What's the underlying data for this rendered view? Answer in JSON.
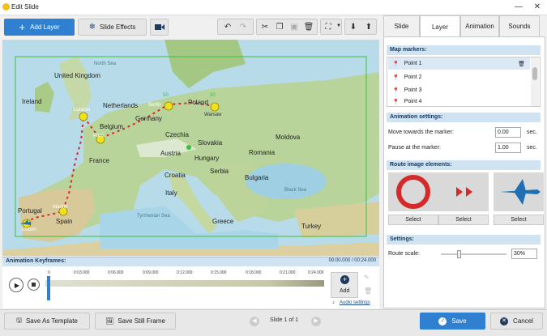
{
  "window": {
    "title": "Edit Slide",
    "minimize": "—",
    "close": "✕"
  },
  "toolbar": {
    "add_layer": "Add Layer",
    "slide_effects": "Slide Effects"
  },
  "map_labels": {
    "north_sea": "North Sea",
    "united_kingdom": "United Kingdom",
    "ireland": "Ireland",
    "london": "London",
    "netherlands": "Netherlands",
    "berlin": "Berlin",
    "poland": "Poland",
    "warsaw": "Warsaw",
    "belgium": "Belgium",
    "germany": "Germany",
    "paris": "Paris",
    "czechia": "Czechia",
    "slovakia": "Slovakia",
    "moldova": "Moldova",
    "austria": "Austria",
    "hungary": "Hungary",
    "france": "France",
    "romania": "Romania",
    "croatia": "Croatia",
    "serbia": "Serbia",
    "bulgaria": "Bulgaria",
    "black_sea": "Black Sea",
    "italy": "Italy",
    "portugal": "Portugal",
    "madrid": "Madrid",
    "spain": "Spain",
    "tyrrhenian_sea": "Tyrrhenian Sea",
    "greece": "Greece",
    "turkey": "Turkey",
    "lisbon": "Lisbon"
  },
  "map_marker_numbers": {
    "berlin": "50",
    "warsaw": "50"
  },
  "keyframes": {
    "title": "Animation Keyframes:",
    "time_display": "00:00.000 / 00:24.000",
    "ticks": [
      "0",
      "0:03.000",
      "0:06.000",
      "0:09.000",
      "0:12.000",
      "0:15.000",
      "0:18.000",
      "0:21.000",
      "0:24.000"
    ],
    "add": "Add",
    "audio_settings": "Audio settings"
  },
  "bottom": {
    "save_template": "Save As Template",
    "save_frame": "Save Still Frame",
    "slide_indicator": "Slide 1 of 1",
    "save": "Save",
    "cancel": "Cancel"
  },
  "tabs": [
    "Slide",
    "Layer",
    "Animation",
    "Sounds"
  ],
  "active_tab": "Layer",
  "panel": {
    "map_markers": "Map markers:",
    "points": [
      "Point 1",
      "Point 2",
      "Point 3",
      "Point 4"
    ],
    "animation_settings": "Animation settings:",
    "move_label": "Move towards the marker:",
    "move_value": "0.00",
    "pause_label": "Pause at the marker:",
    "pause_value": "1.00",
    "unit": "sec.",
    "route_elements": "Route image elements:",
    "select": "Select",
    "settings": "Settings:",
    "route_scale_label": "Route scale:",
    "route_scale_value": "30%"
  },
  "colors": {
    "accent": "#2f80d0",
    "section_header": "#cfe3f3",
    "route": "#d42a2a",
    "frame": "#3cbf3c"
  }
}
